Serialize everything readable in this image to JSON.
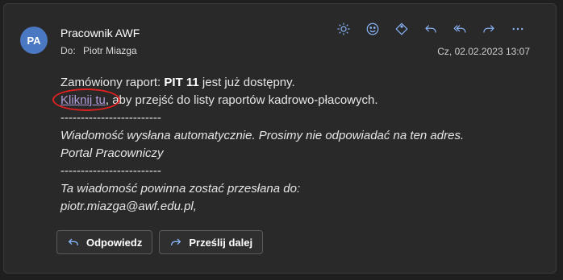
{
  "header": {
    "avatar_initials": "PA",
    "sender_name": "Pracownik AWF",
    "to_label": "Do:",
    "to_name": "Piotr Miazga",
    "date": "Cz, 02.02.2023 13:07"
  },
  "actions": [
    {
      "icon": "sun-icon"
    },
    {
      "icon": "emoji-icon"
    },
    {
      "icon": "tag-icon"
    },
    {
      "icon": "reply-icon"
    },
    {
      "icon": "reply-all-icon"
    },
    {
      "icon": "forward-icon"
    },
    {
      "icon": "more-icon"
    }
  ],
  "body": {
    "line1_prefix": "Zamówiony raport: ",
    "line1_bold": "PIT 11",
    "line1_suffix": " jest już dostępny.",
    "link_text": "Kliknij tu",
    "line2_after_link": ", aby przejść do listy raportów kadrowo-płacowych.",
    "separator1": "-------------------------",
    "auto_note": "Wiadomość wysłana automatycznie. Prosimy nie odpowiadać na ten adres.",
    "portal": "Portal Pracowniczy",
    "separator2": "-------------------------",
    "forward_note": "Ta wiadomość powinna zostać przesłana do:",
    "forward_email": "piotr.miazga@awf.edu.pl,"
  },
  "buttons": {
    "reply": "Odpowiedz",
    "forward": "Prześlij dalej"
  },
  "colors": {
    "background": "#292929",
    "accent": "#8ab4f8",
    "link": "#b39ddb",
    "highlight_circle": "#e02020"
  }
}
